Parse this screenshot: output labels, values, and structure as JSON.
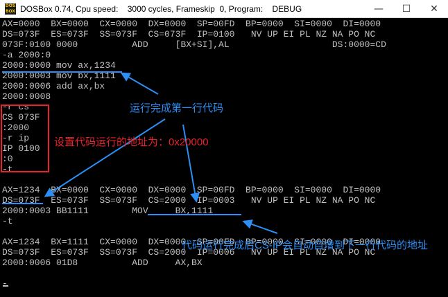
{
  "window": {
    "icon_text": "DOS BOX",
    "title": "DOSBox 0.74, Cpu speed:    3000 cycles, Frameskip  0, Program:    DEBUG",
    "min_glyph": "—",
    "max_glyph": "☐",
    "close_glyph": "✕"
  },
  "console": {
    "lines": [
      "AX=0000  BX=0000  CX=0000  DX=0000  SP=00FD  BP=0000  SI=0000  DI=0000",
      "DS=073F  ES=073F  SS=073F  CS=073F  IP=0100   NV UP EI PL NZ NA PO NC",
      "073F:0100 0000          ADD     [BX+SI],AL                   DS:0000=CD",
      "-a 2000:0",
      "2000:0000 mov ax,1234",
      "2000:0003 mov bx,1111",
      "2000:0006 add ax,bx",
      "2000:0008",
      "-r cs",
      "CS 073F",
      ":2000",
      "-r ip",
      "IP 0100",
      ":0",
      "-t",
      "",
      "AX=1234  BX=0000  CX=0000  DX=0000  SP=00FD  BP=0000  SI=0000  DI=0000",
      "DS=073F  ES=073F  SS=073F  CS=2000  IP=0003   NV UP EI PL NZ NA PO NC",
      "2000:0003 BB1111        MOV     BX,1111",
      "-t",
      "",
      "AX=1234  BX=1111  CX=0000  DX=0000  SP=00FD  BP=0000  SI=0000  DI=0000",
      "DS=073F  ES=073F  SS=073F  CS=2000  IP=0006   NV UP EI PL NZ NA PO NC",
      "2000:0006 01D8          ADD     AX,BX",
      "-"
    ]
  },
  "annotations": {
    "first_line_done": "运行完成第一行代码",
    "set_address": "设置代码运行的地址为：0x20000",
    "after_run": "代码运行完成后CS-IP会自动自增到下一行代码的地址"
  },
  "colors": {
    "console_bg": "#000000",
    "console_text": "#c0c0c0",
    "annotation_blue": "#2b8ff5",
    "annotation_red": "#e8232a"
  }
}
